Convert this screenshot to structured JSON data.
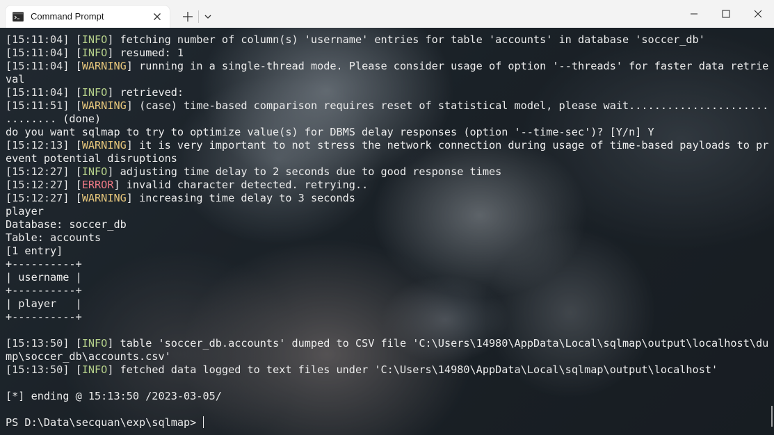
{
  "window": {
    "tab_title": "Command Prompt",
    "tab_icon": "terminal-icon",
    "new_tab_icon": "plus-icon",
    "dropdown_icon": "chevron-down-icon",
    "controls": [
      "minimize-icon",
      "maximize-icon",
      "close-icon"
    ]
  },
  "colors": {
    "info": "#b5d08a",
    "warning": "#e7c77c",
    "error": "#ee7a86",
    "text": "#ececec"
  },
  "terminal": {
    "lines": [
      {
        "ts": "15:11:04",
        "level": "INFO",
        "msg": " fetching number of column(s) 'username' entries for table 'accounts' in database 'soccer_db'"
      },
      {
        "ts": "15:11:04",
        "level": "INFO",
        "msg": " resumed: 1"
      },
      {
        "ts": "15:11:04",
        "level": "WARNING",
        "msg": " running in a single-thread mode. Please consider usage of option '--threads' for faster data retrie"
      },
      {
        "text": "val"
      },
      {
        "ts": "15:11:04",
        "level": "INFO",
        "msg": " retrieved:"
      },
      {
        "ts": "15:11:51",
        "level": "WARNING",
        "msg": " (case) time-based comparison requires reset of statistical model, please wait......................"
      },
      {
        "text": "........ (done)"
      },
      {
        "text": "do you want sqlmap to try to optimize value(s) for DBMS delay responses (option '--time-sec')? [Y/n] Y"
      },
      {
        "ts": "15:12:13",
        "level": "WARNING",
        "msg": " it is very important to not stress the network connection during usage of time-based payloads to pr"
      },
      {
        "text": "event potential disruptions"
      },
      {
        "ts": "15:12:27",
        "level": "INFO",
        "msg": " adjusting time delay to 2 seconds due to good response times"
      },
      {
        "ts": "15:12:27",
        "level": "ERROR",
        "msg": " invalid character detected. retrying.."
      },
      {
        "ts": "15:12:27",
        "level": "WARNING",
        "msg": " increasing time delay to 3 seconds"
      },
      {
        "text": "player"
      },
      {
        "text": "Database: soccer_db"
      },
      {
        "text": "Table: accounts"
      },
      {
        "text": "[1 entry]"
      },
      {
        "text": "+----------+"
      },
      {
        "text": "| username |"
      },
      {
        "text": "+----------+"
      },
      {
        "text": "| player   |"
      },
      {
        "text": "+----------+"
      },
      {
        "text": ""
      },
      {
        "ts": "15:13:50",
        "level": "INFO",
        "msg": " table 'soccer_db.accounts' dumped to CSV file 'C:\\Users\\14980\\AppData\\Local\\sqlmap\\output\\localhost\\du"
      },
      {
        "text": "mp\\soccer_db\\accounts.csv'"
      },
      {
        "ts": "15:13:50",
        "level": "INFO",
        "msg": " fetched data logged to text files under 'C:\\Users\\14980\\AppData\\Local\\sqlmap\\output\\localhost'"
      },
      {
        "text": ""
      },
      {
        "text": "[*] ending @ 15:13:50 /2023-03-05/"
      },
      {
        "text": ""
      },
      {
        "text": "PS D:\\Data\\secquan\\exp\\sqlmap> ",
        "cursor": true
      }
    ]
  }
}
